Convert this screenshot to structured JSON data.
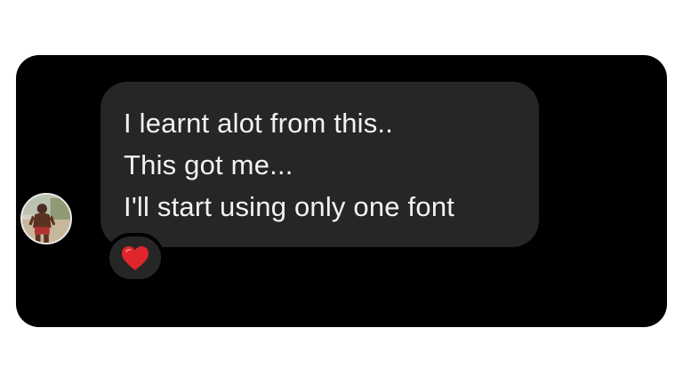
{
  "message": {
    "lines": [
      "I learnt alot from this..",
      "This got me...",
      "I'll start using only one font"
    ]
  },
  "reaction": {
    "icon": "red-heart-icon",
    "color": "#e0262c"
  },
  "colors": {
    "background": "#000000",
    "bubble": "#262626",
    "text": "#f2f2f2"
  }
}
